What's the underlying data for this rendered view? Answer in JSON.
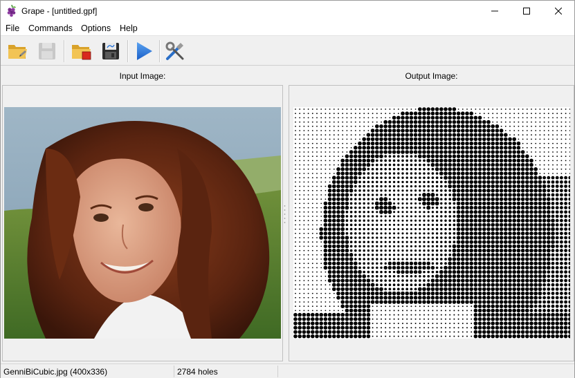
{
  "window": {
    "title": "Grape - [untitled.gpf]"
  },
  "menu": {
    "items": [
      "File",
      "Commands",
      "Options",
      "Help"
    ]
  },
  "toolbar": {
    "buttons": [
      {
        "icon": "open-folder-icon",
        "enabled": true
      },
      {
        "icon": "save-icon",
        "enabled": false
      },
      {
        "icon": "open-image-icon",
        "enabled": true
      },
      {
        "icon": "export-icon",
        "enabled": true
      },
      {
        "icon": "run-icon",
        "enabled": true
      },
      {
        "icon": "settings-tools-icon",
        "enabled": true
      }
    ]
  },
  "panels": {
    "input_label": "Input Image:",
    "output_label": "Output Image:"
  },
  "status": {
    "file_info": "GenniBiCubic.jpg (400x336)",
    "holes": "2784 holes"
  },
  "colors": {
    "accent_blue": "#1e6fd9",
    "folder_yellow": "#e8b43a",
    "window_bg": "#f0f0f0"
  }
}
